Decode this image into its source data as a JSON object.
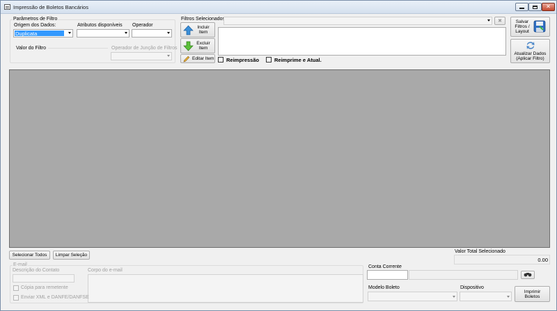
{
  "window": {
    "title": "Impressão de Boletos Bancários"
  },
  "filter_params": {
    "group_label": "Parâmetros de Filtro",
    "origem_label": "Origem dos Dados:",
    "origem_value": "Duplicata",
    "atributos_label": "Atributos disponíveis",
    "operador_label": "Operador",
    "valor_label": "Valor do Filtro",
    "juncao_label": "Operador de Junção de Filtros"
  },
  "selected_filters": {
    "group_label": "Filtros Selecionados",
    "incluir_label": "Incluir Item",
    "excluir_label": "Excluir Item",
    "editar_label": "Editar Item",
    "reimpressao_label": "Reimpressão",
    "reimprime_label": "Reimprime e Atual."
  },
  "right_panel": {
    "salvar_label": "Salvar Filtros / Layout",
    "atualizar_label": "Atualizar Dados (Aplicar Filtro)"
  },
  "grid_actions": {
    "selecionar_todos": "Selecionar Todos",
    "limpar_selecao": "Limpar Seleção",
    "valor_total_label": "Valor Total Selecionado",
    "valor_total_value": "0.00"
  },
  "email": {
    "group_label": "E-mail",
    "descricao_label": "Descrição do Contato",
    "corpo_label": "Corpo do e-mail",
    "copia_label": "Cópia para remetente",
    "enviar_xml_label": "Enviar XML e DANFE/DANFSE"
  },
  "bank": {
    "conta_label": "Conta Corrente",
    "modelo_label": "Modelo Boleto",
    "dispositivo_label": "Dispositivo",
    "imprimir_label": "Imprimir Boletos"
  },
  "icons": {
    "incluir": "arrow-up-icon",
    "excluir": "arrow-down-icon",
    "editar": "pencil-icon",
    "salvar": "floppy-disk-icon",
    "atualizar": "refresh-icon",
    "binoculars": "binoculars-icon"
  },
  "colors": {
    "selection": "#3399ff",
    "grid_background": "#a9a9a9",
    "window_background": "#f0f0f0"
  }
}
